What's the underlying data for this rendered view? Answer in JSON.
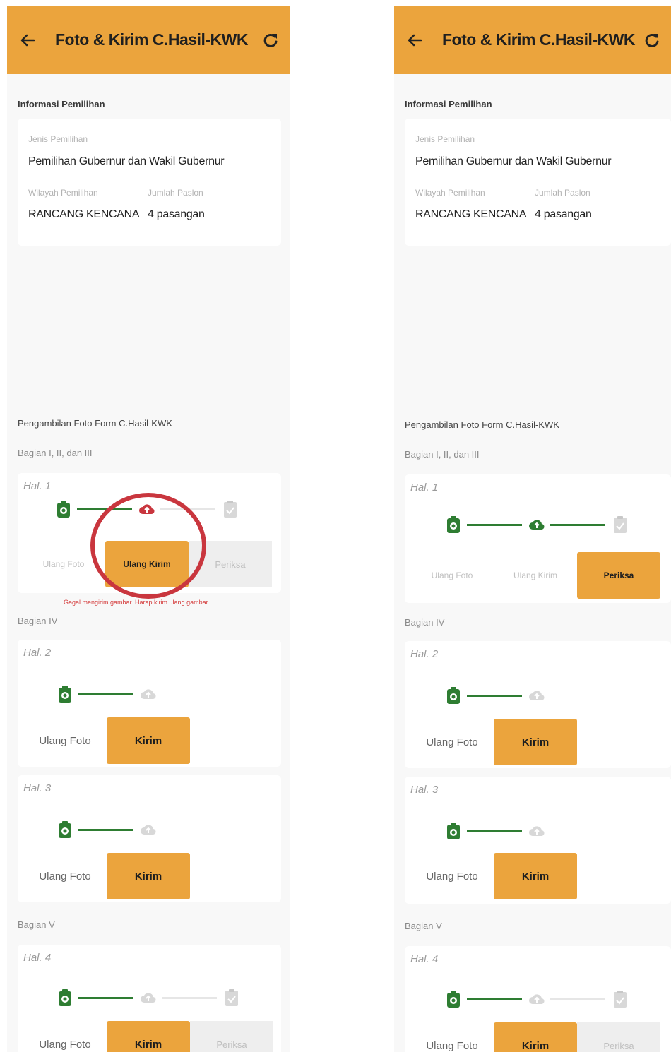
{
  "left": {
    "appbar": {
      "title": "Foto & Kirim C.Hasil-KWK"
    },
    "info": {
      "section_title": "Informasi Pemilihan",
      "jenis_label": "Jenis Pemilihan",
      "jenis_value": "Pemilihan Gubernur dan Wakil Gubernur",
      "wilayah_label": "Wilayah Pemilihan",
      "wilayah_value": "RANCANG KENCANA",
      "paslon_label": "Jumlah Paslon",
      "paslon_value": "4 pasangan"
    },
    "photo_section_title": "Pengambilan Foto Form C.Hasil-KWK",
    "groups": {
      "g1": "Bagian I, II, dan III",
      "g2": "Bagian IV",
      "g3": "Bagian V"
    },
    "pages": {
      "p1": {
        "hal": "Hal. 1",
        "b1": "Ulang Foto",
        "b2": "Ulang Kirim",
        "b3": "Periksa",
        "error": "Gagal mengirim gambar. Harap kirim ulang gambar."
      },
      "p2": {
        "hal": "Hal. 2",
        "b1": "Ulang Foto",
        "b2": "Kirim"
      },
      "p3": {
        "hal": "Hal. 3",
        "b1": "Ulang Foto",
        "b2": "Kirim"
      },
      "p4": {
        "hal": "Hal. 4",
        "b1": "Ulang Foto",
        "b2": "Kirim",
        "b3": "Periksa"
      }
    }
  },
  "right": {
    "appbar": {
      "title": "Foto & Kirim C.Hasil-KWK"
    },
    "info": {
      "section_title": "Informasi Pemilihan",
      "jenis_label": "Jenis Pemilihan",
      "jenis_value": "Pemilihan Gubernur dan Wakil Gubernur",
      "wilayah_label": "Wilayah Pemilihan",
      "wilayah_value": "RANCANG KENCANA",
      "paslon_label": "Jumlah Paslon",
      "paslon_value": "4 pasangan"
    },
    "photo_section_title": "Pengambilan Foto Form C.Hasil-KWK",
    "groups": {
      "g1": "Bagian I, II, dan III",
      "g2": "Bagian IV",
      "g3": "Bagian V"
    },
    "pages": {
      "p1": {
        "hal": "Hal. 1",
        "b1": "Ulang Foto",
        "b2": "Ulang Kirim",
        "b3": "Periksa"
      },
      "p2": {
        "hal": "Hal. 2",
        "b1": "Ulang Foto",
        "b2": "Kirim"
      },
      "p3": {
        "hal": "Hal. 3",
        "b1": "Ulang Foto",
        "b2": "Kirim"
      },
      "p4": {
        "hal": "Hal. 4",
        "b1": "Ulang Foto",
        "b2": "Kirim",
        "b3": "Periksa"
      }
    }
  },
  "colors": {
    "accent": "#eba43d",
    "success": "#2e7d32",
    "error": "#d43c3c",
    "disabled": "#d8d8d8"
  },
  "icons": [
    "back-arrow-icon",
    "refresh-icon",
    "camera-icon",
    "upload-cloud-icon",
    "clipboard-check-icon"
  ]
}
